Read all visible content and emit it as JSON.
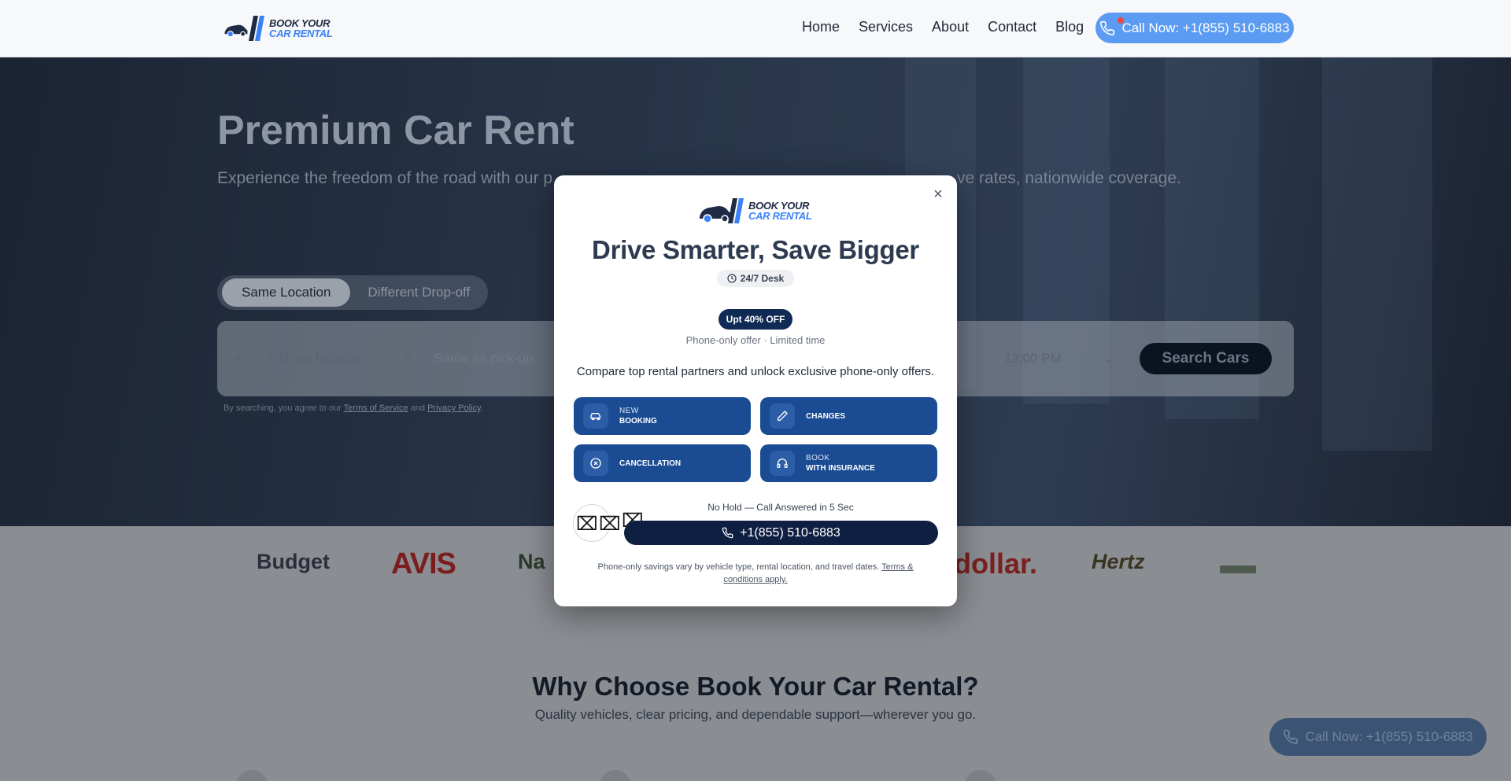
{
  "header": {
    "logo": {
      "line1": "BOOK YOUR",
      "line2": "CAR RENTAL"
    },
    "nav": [
      "Home",
      "Services",
      "About",
      "Contact",
      "Blog"
    ],
    "call_label": "Call Now: +1(855) 510-6883"
  },
  "hero": {
    "title": "Premium Car Rent",
    "subtitle_left": "Experience the freedom of the road with our p",
    "subtitle_right": "ve rates, nationwide coverage.",
    "toggle": {
      "active": "Same Location",
      "inactive": "Different Drop-off"
    },
    "search": {
      "pickup_placeholder": "Pick-up location",
      "dropoff_placeholder": "Same as pick-up",
      "time_value": "12:00 PM",
      "button": "Search Cars"
    },
    "terms": {
      "prefix": "By searching, you agree to our",
      "tos": "Terms of Service",
      "and": "and",
      "privacy": "Privacy Policy",
      "suffix": "."
    }
  },
  "brands": [
    "Budget",
    "AVIS",
    "Na",
    "dollar.",
    "Hertz"
  ],
  "why": {
    "title": "Why Choose Book Your Car Rental?",
    "subtitle": "Quality vehicles, clear pricing, and dependable support—wherever you go."
  },
  "floating_call": "Call Now: +1(855) 510-6883",
  "modal": {
    "logo": {
      "line1": "BOOK YOUR",
      "line2": "CAR RENTAL"
    },
    "close": "×",
    "title": "Drive Smarter, Save Bigger",
    "desk_badge": "24/7 Desk",
    "offer_badge": "Upt 40% OFF",
    "phone_only": "Phone-only offer · Limited time",
    "compare": "Compare top rental partners and unlock exclusive phone-only offers.",
    "options": [
      {
        "small": "NEW",
        "label": "BOOKING",
        "icon": "car-icon"
      },
      {
        "small": "",
        "label": "CHANGES",
        "icon": "pencil-icon"
      },
      {
        "small": "",
        "label": "CANCELLATION",
        "icon": "cancel-icon"
      },
      {
        "small": "BOOK",
        "label": "WITH INSURANCE",
        "icon": "headset-icon"
      }
    ],
    "no_hold": "No Hold — Call Answered in 5 Sec",
    "call_number": "+1(855) 510-6883",
    "disclaimer": "Phone-only savings vary by vehicle type, rental location, and travel dates.",
    "disclaimer_link": "Terms & conditions apply."
  },
  "colors": {
    "accent_blue": "#5b9cf2",
    "option_blue": "#1a4b93",
    "navy": "#0f1f42",
    "title_slate": "#2d3a4f"
  }
}
